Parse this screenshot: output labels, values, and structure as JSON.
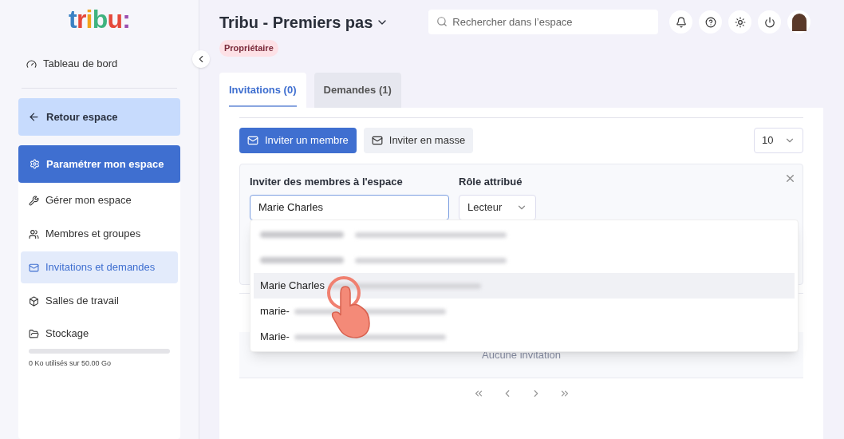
{
  "sidebar": {
    "logo": "tribu:",
    "dashboard": {
      "label": "Tableau de bord"
    },
    "back": {
      "label": "Retour espace"
    },
    "section": {
      "label": "Paramétrer mon espace"
    },
    "items": [
      {
        "label": "Gérer mon espace",
        "kind": "wrench",
        "selected": false
      },
      {
        "label": "Membres et groupes",
        "kind": "users",
        "selected": false
      },
      {
        "label": "Invitations et demandes",
        "kind": "mail",
        "selected": true
      },
      {
        "label": "Salles de travail",
        "kind": "box",
        "selected": false
      }
    ],
    "storage": {
      "label": "Stockage",
      "level": 0,
      "usage": "0 Ko utilisés sur 50.00 Go"
    }
  },
  "header": {
    "title": "Tribu - Premiers pas",
    "role_badge": "Propriétaire",
    "search": {
      "placeholder": "Rechercher dans l’espace"
    }
  },
  "tabs": [
    {
      "label": "Invitations (0)",
      "selected": true
    },
    {
      "label": "Demandes (1)",
      "selected": false
    }
  ],
  "toolbar": {
    "buttons": [
      {
        "label": "Inviter un membre",
        "selected": true
      },
      {
        "label": "Inviter en masse",
        "selected": false
      }
    ],
    "page_size": "10"
  },
  "invite_form": {
    "members_label": "Inviter des membres à l'espace",
    "members_value": "Marie Charles",
    "role_label": "Rôle attribué",
    "role_value": "Lecteur"
  },
  "suggestions": [
    {
      "kind": "blurred",
      "selected": false
    },
    {
      "kind": "blurred",
      "selected": false
    },
    {
      "kind": "partial",
      "name": "Marie Charles",
      "selected": true
    },
    {
      "kind": "partial",
      "name": "marie-",
      "selected": false
    },
    {
      "kind": "partial",
      "name": "Marie-",
      "selected": false
    }
  ],
  "table": {
    "empty_message": "Aucune invitation"
  }
}
